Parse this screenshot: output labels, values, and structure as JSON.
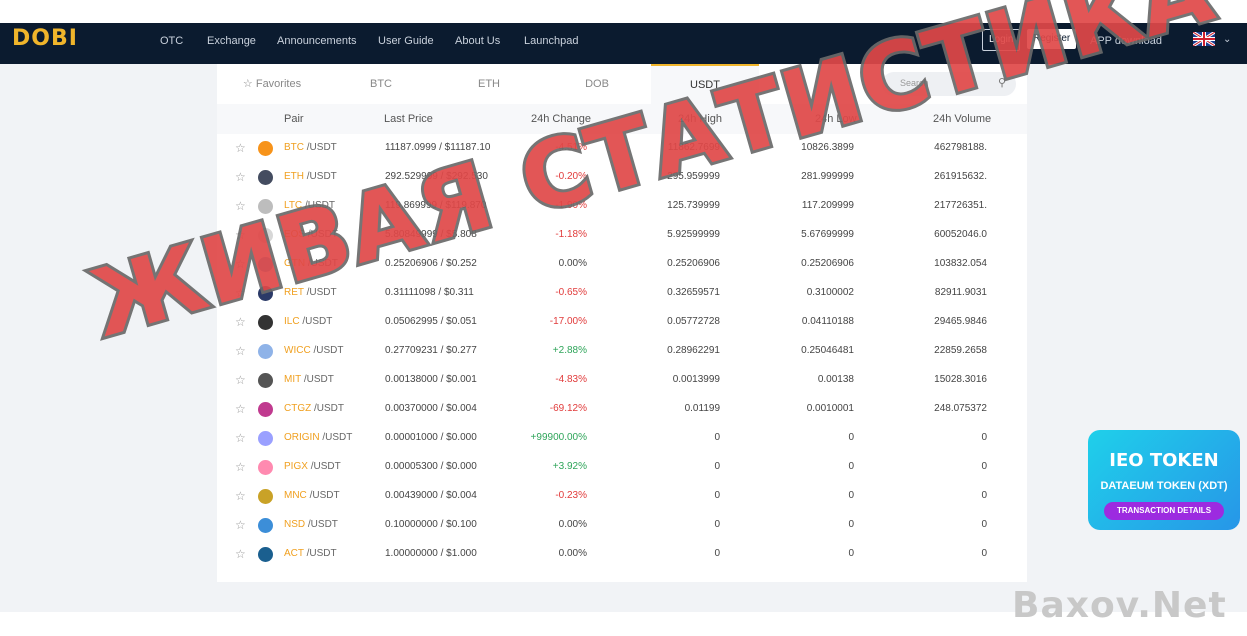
{
  "header": {
    "logo": "DOBI",
    "nav": [
      "OTC",
      "Exchange",
      "Announcements",
      "User Guide",
      "About Us",
      "Launchpad"
    ],
    "login": "Login",
    "register": "Register",
    "app_download": "APP download",
    "flag_icon": "uk-flag-icon"
  },
  "tabs": [
    {
      "label": "Favorites",
      "icon": "star-outline-icon"
    },
    {
      "label": "BTC"
    },
    {
      "label": "ETH"
    },
    {
      "label": "DOB"
    },
    {
      "label": "USDT",
      "active": true
    }
  ],
  "search": {
    "placeholder": "Search"
  },
  "table": {
    "headers": [
      "Pair",
      "Last Price",
      "24h Change",
      "24h High",
      "24h Low",
      "24h Volume"
    ],
    "rows": [
      {
        "base": "BTC",
        "quote": "/USDT",
        "price": "11187.0999 /  $11187.10",
        "change": "-4.51%",
        "high": "11862.7699",
        "low": "10826.3899",
        "volume": "462798188.",
        "color": "#f7931a"
      },
      {
        "base": "ETH",
        "quote": "/USDT",
        "price": "292.529999 /  $292.530",
        "change": "-0.20%",
        "high": "295.959999",
        "low": "281.999999",
        "volume": "261915632.",
        "color": "#444c60"
      },
      {
        "base": "LTC",
        "quote": "/USDT",
        "price": "119.869999 /  $119.870",
        "change": "-1.90%",
        "high": "125.739999",
        "low": "117.209999",
        "volume": "217726351.",
        "color": "#bdbdbd"
      },
      {
        "base": "EOS",
        "quote": "/USDT",
        "price": "5.80849999 /  $5.808",
        "change": "-1.18%",
        "high": "5.92599999",
        "low": "5.67699999",
        "volume": "60052046.0",
        "color": "#d7d7d7"
      },
      {
        "base": "GTN",
        "quote": "/USDT",
        "price": "0.25206906 /  $0.252",
        "change": "0.00%",
        "high": "0.25206906",
        "low": "0.25206906",
        "volume": "103832.054",
        "color": "#4aa3df"
      },
      {
        "base": "RET",
        "quote": "/USDT",
        "price": "0.31111098 /  $0.311",
        "change": "-0.65%",
        "high": "0.32659571",
        "low": "0.3100002",
        "volume": "82911.9031",
        "color": "#2b3a67"
      },
      {
        "base": "ILC",
        "quote": "/USDT",
        "price": "0.05062995 /  $0.051",
        "change": "-17.00%",
        "high": "0.05772728",
        "low": "0.04110188",
        "volume": "29465.9846",
        "color": "#333333"
      },
      {
        "base": "WICC",
        "quote": "/USDT",
        "price": "0.27709231 /  $0.277",
        "change": "+2.88%",
        "high": "0.28962291",
        "low": "0.25046481",
        "volume": "22859.2658",
        "color": "#8fb3e8"
      },
      {
        "base": "MIT",
        "quote": "/USDT",
        "price": "0.00138000 /  $0.001",
        "change": "-4.83%",
        "high": "0.0013999",
        "low": "0.00138",
        "volume": "15028.3016",
        "color": "#555555"
      },
      {
        "base": "CTGZ",
        "quote": "/USDT",
        "price": "0.00370000 /  $0.004",
        "change": "-69.12%",
        "high": "0.01199",
        "low": "0.0010001",
        "volume": "248.075372",
        "color": "#c03a8f"
      },
      {
        "base": "ORIGIN",
        "quote": "/USDT",
        "price": "0.00001000 /  $0.000",
        "change": "+99900.00%",
        "high": "0",
        "low": "0",
        "volume": "0",
        "color": "#9aa0ff"
      },
      {
        "base": "PIGX",
        "quote": "/USDT",
        "price": "0.00005300 /  $0.000",
        "change": "+3.92%",
        "high": "0",
        "low": "0",
        "volume": "0",
        "color": "#ff8ab0"
      },
      {
        "base": "MNC",
        "quote": "/USDT",
        "price": "0.00439000 /  $0.004",
        "change": "-0.23%",
        "high": "0",
        "low": "0",
        "volume": "0",
        "color": "#c9a227"
      },
      {
        "base": "NSD",
        "quote": "/USDT",
        "price": "0.10000000 /  $0.100",
        "change": "0.00%",
        "high": "0",
        "low": "0",
        "volume": "0",
        "color": "#3c8ed8"
      },
      {
        "base": "ACT",
        "quote": "/USDT",
        "price": "1.00000000 /  $1.000",
        "change": "0.00%",
        "high": "0",
        "low": "0",
        "volume": "0",
        "color": "#1a5f8f"
      }
    ]
  },
  "watermark": "ЖИВАЯ СТАТИСТИКА",
  "banner": {
    "title": "IEO TOKEN",
    "subtitle": "DATAEUM TOKEN (XDT)",
    "button": "TRANSACTION DETAILS"
  },
  "brand_watermark": "Baxov.Net"
}
